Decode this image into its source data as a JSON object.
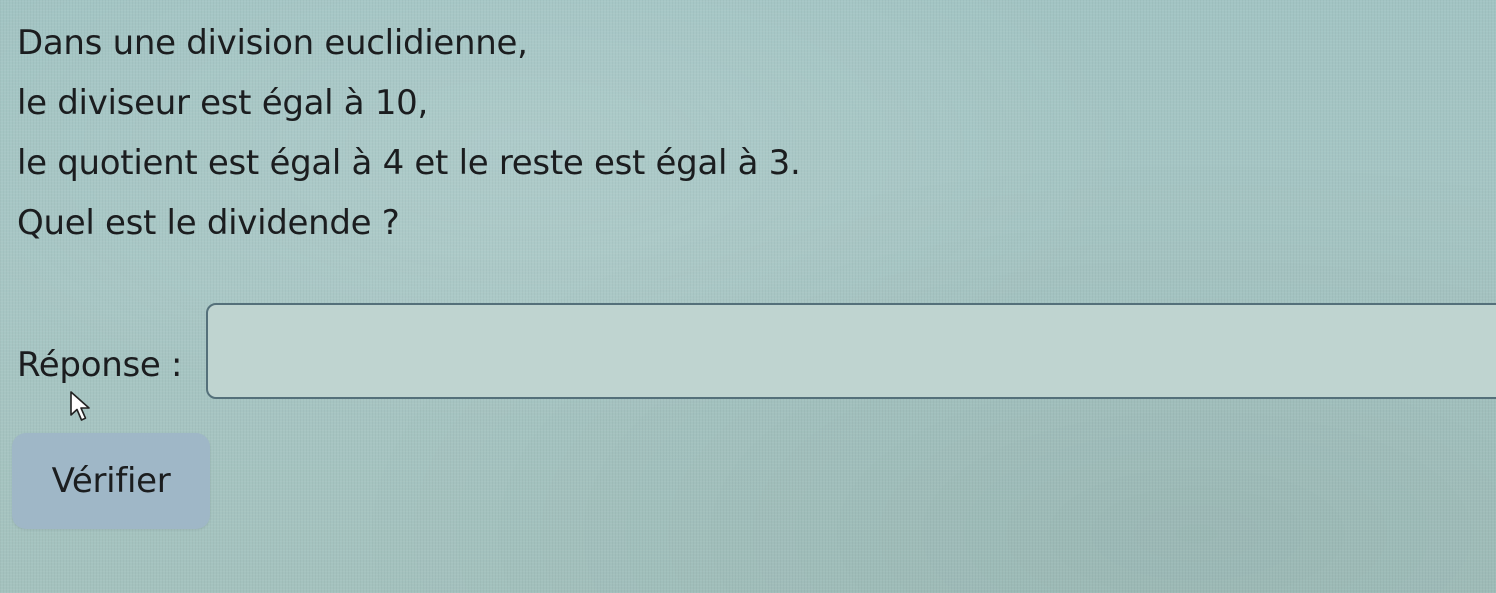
{
  "question": {
    "lines": [
      "Dans une division euclidienne,",
      "le diviseur est égal à 10,",
      "le quotient est égal à 4 et le reste est égal à 3.",
      "Quel est le dividende ?"
    ]
  },
  "answer": {
    "label": "Réponse :",
    "value": ""
  },
  "actions": {
    "verify_label": "Vérifier"
  },
  "icons": {
    "cursor": "mouse-pointer-icon"
  },
  "colors": {
    "background": "#a4c4c2",
    "input_background": "#bfd4d0",
    "input_border": "#54707a",
    "button_background": "#9fb7c7",
    "text": "#1b1d1f"
  }
}
